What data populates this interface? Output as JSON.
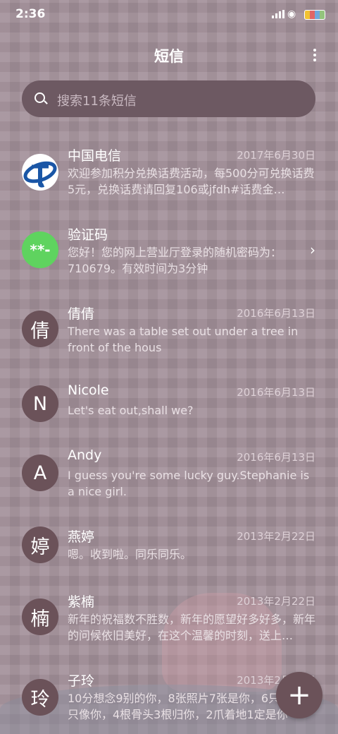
{
  "status": {
    "time": "2:36"
  },
  "header": {
    "title": "短信"
  },
  "search": {
    "placeholder": "搜索11条短信"
  },
  "messages": [
    {
      "avatar": "",
      "name": "中国电信",
      "date": "2017年6月30日",
      "preview": "欢迎参加积分兑换话费活动，每500分可兑换话费5元，兑换话费请回复106或jfdh#话费金…"
    },
    {
      "avatar": "**-",
      "name": "验证码",
      "date": "",
      "preview": "您好！您的网上营业厅登录的随机密码为：710679。有效时间为3分钟"
    },
    {
      "avatar": "倩",
      "name": "倩倩",
      "date": "2016年6月13日",
      "preview": "There was a table set out under a tree in front of the hous"
    },
    {
      "avatar": "N",
      "name": "Nicole",
      "date": "2016年6月13日",
      "preview": "Let's eat out,shall we?"
    },
    {
      "avatar": "A",
      "name": "Andy",
      "date": "2016年6月13日",
      "preview": "I guess you're some lucky guy.Stephanie is a nice girl."
    },
    {
      "avatar": "婷",
      "name": "燕婷",
      "date": "2013年2月22日",
      "preview": "嗯。收到啦。同乐同乐。"
    },
    {
      "avatar": "楠",
      "name": "紫楠",
      "date": "2013年2月22日",
      "preview": "新年的祝福数不胜数，新年的愿望好多好多，新年的问候依旧美好，在这个温馨的时刻，送上…"
    },
    {
      "avatar": "玲",
      "name": "子玲",
      "date": "2013年2月22日",
      "preview": "10分想念9别的你，8张照片7张是你，6只眼睛5只像你，4根骨头3根归你，2爪着地1定是你"
    }
  ],
  "fab": {
    "label": "+"
  }
}
